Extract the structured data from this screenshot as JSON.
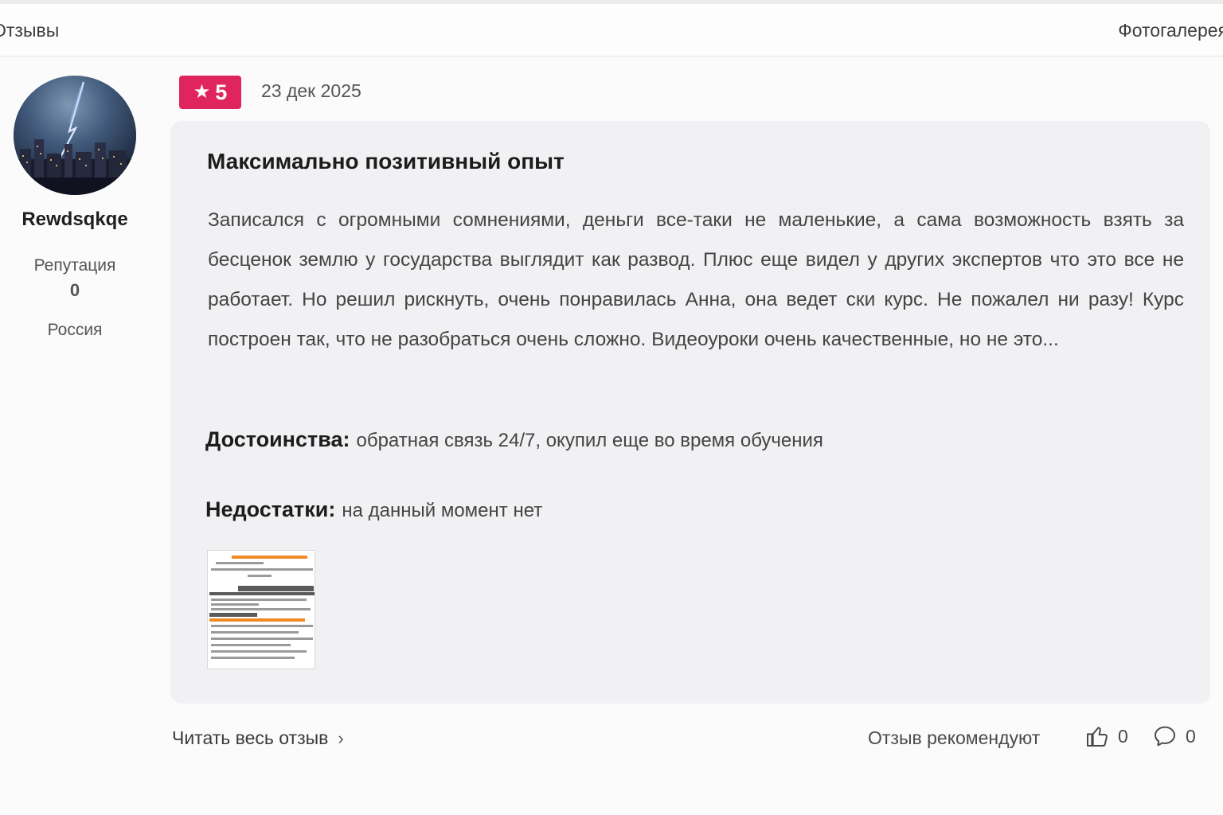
{
  "tabs": {
    "reviews": "Отзывы",
    "gallery": "Фотогалерея"
  },
  "author": {
    "username": "Rewdsqkqe",
    "reputation_label": "Репутация",
    "reputation_value": "0",
    "country": "Россия"
  },
  "review": {
    "rating": "5",
    "date": "23 дек 2025",
    "title": "Максимально позитивный опыт",
    "text": "Записался с огромными сомнениями, деньги все-таки не маленькие, а сама возможность взять за бесценок землю у государства выглядит как развод. Плюс еще видел у других экспертов что это все не работает. Но решил рискнуть, очень понравилась Анна, она ведет ски курс. Не пожалел ни разу! Курс построен так, что не разобраться очень сложно. Видеоуроки очень качественные, но не это...",
    "pros_label": "Достоинства:",
    "pros": "обратная связь 24/7, окупил еще во время обучения",
    "cons_label": "Недостатки:",
    "cons": "на данный момент нет"
  },
  "footer": {
    "read_full": "Читать весь отзыв",
    "recommend_label": "Отзыв рекомендуют",
    "likes_count": "0",
    "comments_count": "0"
  },
  "colors": {
    "rating_badge": "#e0245e",
    "card_bg": "#f1f1f3"
  }
}
